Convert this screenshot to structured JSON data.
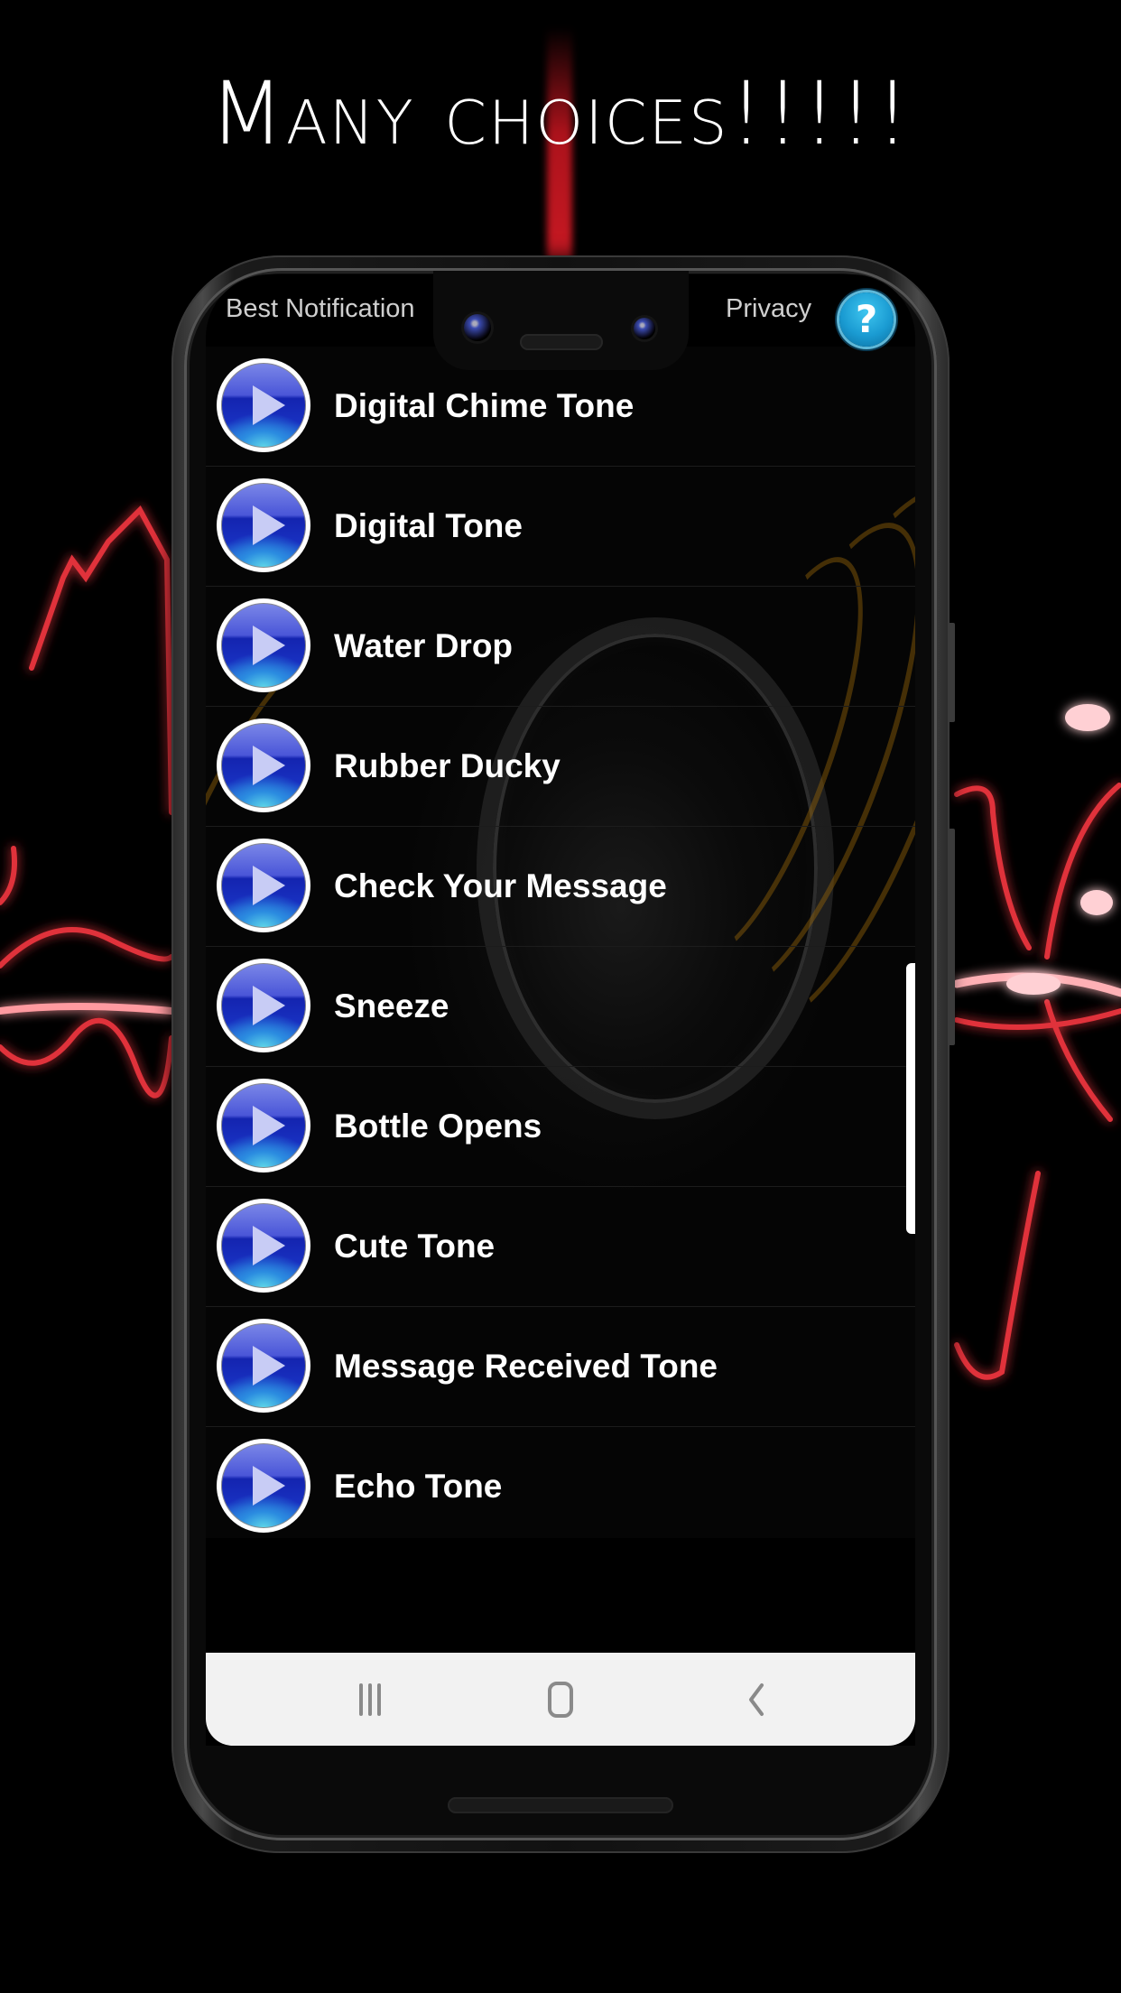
{
  "promo": {
    "headline": "Many choices!!!!!"
  },
  "app_header": {
    "title": "Best Notification",
    "privacy_label": "Privacy",
    "help_symbol": "?",
    "help_icon": "question-mark-icon"
  },
  "tones": [
    {
      "label": "Digital Chime Tone",
      "icon": "play-icon"
    },
    {
      "label": "Digital Tone",
      "icon": "play-icon"
    },
    {
      "label": "Water Drop",
      "icon": "play-icon"
    },
    {
      "label": "Rubber Ducky",
      "icon": "play-icon"
    },
    {
      "label": "Check Your Message",
      "icon": "play-icon"
    },
    {
      "label": "Sneeze",
      "icon": "play-icon"
    },
    {
      "label": "Bottle Opens",
      "icon": "play-icon"
    },
    {
      "label": "Cute Tone",
      "icon": "play-icon"
    },
    {
      "label": "Message Received Tone",
      "icon": "play-icon"
    },
    {
      "label": "Echo Tone",
      "icon": "play-icon"
    }
  ],
  "nav_bar": {
    "recents_icon": "recents-icon",
    "home_icon": "home-icon",
    "back_icon": "back-chevron-icon"
  },
  "colors": {
    "accent_red": "#c8141e",
    "help_blue": "#1a9bd2",
    "play_blue": "#1424b0",
    "nav_bar_bg": "#f2f2f2",
    "text": "#ffffff",
    "header_text": "#cfcfcf"
  }
}
